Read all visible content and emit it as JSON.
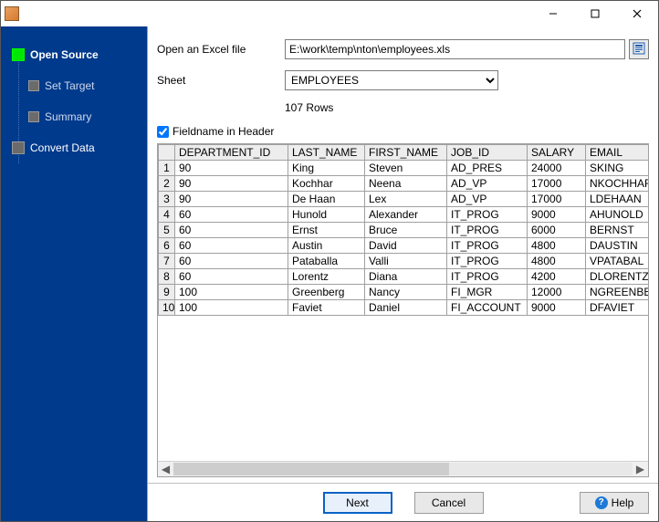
{
  "sidebar": {
    "steps": [
      {
        "label": "Open Source",
        "active": true,
        "sub": false
      },
      {
        "label": "Set Target",
        "active": false,
        "sub": true
      },
      {
        "label": "Summary",
        "active": false,
        "sub": true
      },
      {
        "label": "Convert Data",
        "active": false,
        "sub": false
      }
    ]
  },
  "form": {
    "open_label": "Open an Excel file",
    "file_path": "E:\\work\\temp\\nton\\employees.xls",
    "sheet_label": "Sheet",
    "sheet_selected": "EMPLOYEES",
    "rows_info": "107 Rows",
    "fieldname_checkbox_label": "Fieldname in Header",
    "fieldname_checked": true
  },
  "grid": {
    "columns": [
      "DEPARTMENT_ID",
      "LAST_NAME",
      "FIRST_NAME",
      "JOB_ID",
      "SALARY",
      "EMAIL"
    ],
    "rows": [
      [
        "90",
        "King",
        "Steven",
        "AD_PRES",
        "24000",
        "SKING"
      ],
      [
        "90",
        "Kochhar",
        "Neena",
        "AD_VP",
        "17000",
        "NKOCHHAR"
      ],
      [
        "90",
        "De Haan",
        "Lex",
        "AD_VP",
        "17000",
        "LDEHAAN"
      ],
      [
        "60",
        "Hunold",
        "Alexander",
        "IT_PROG",
        "9000",
        "AHUNOLD"
      ],
      [
        "60",
        "Ernst",
        "Bruce",
        "IT_PROG",
        "6000",
        "BERNST"
      ],
      [
        "60",
        "Austin",
        "David",
        "IT_PROG",
        "4800",
        "DAUSTIN"
      ],
      [
        "60",
        "Pataballa",
        "Valli",
        "IT_PROG",
        "4800",
        "VPATABAL"
      ],
      [
        "60",
        "Lorentz",
        "Diana",
        "IT_PROG",
        "4200",
        "DLORENTZ"
      ],
      [
        "100",
        "Greenberg",
        "Nancy",
        "FI_MGR",
        "12000",
        "NGREENBE"
      ],
      [
        "100",
        "Faviet",
        "Daniel",
        "FI_ACCOUNT",
        "9000",
        "DFAVIET"
      ]
    ]
  },
  "buttons": {
    "next": "Next",
    "cancel": "Cancel",
    "help": "Help"
  }
}
